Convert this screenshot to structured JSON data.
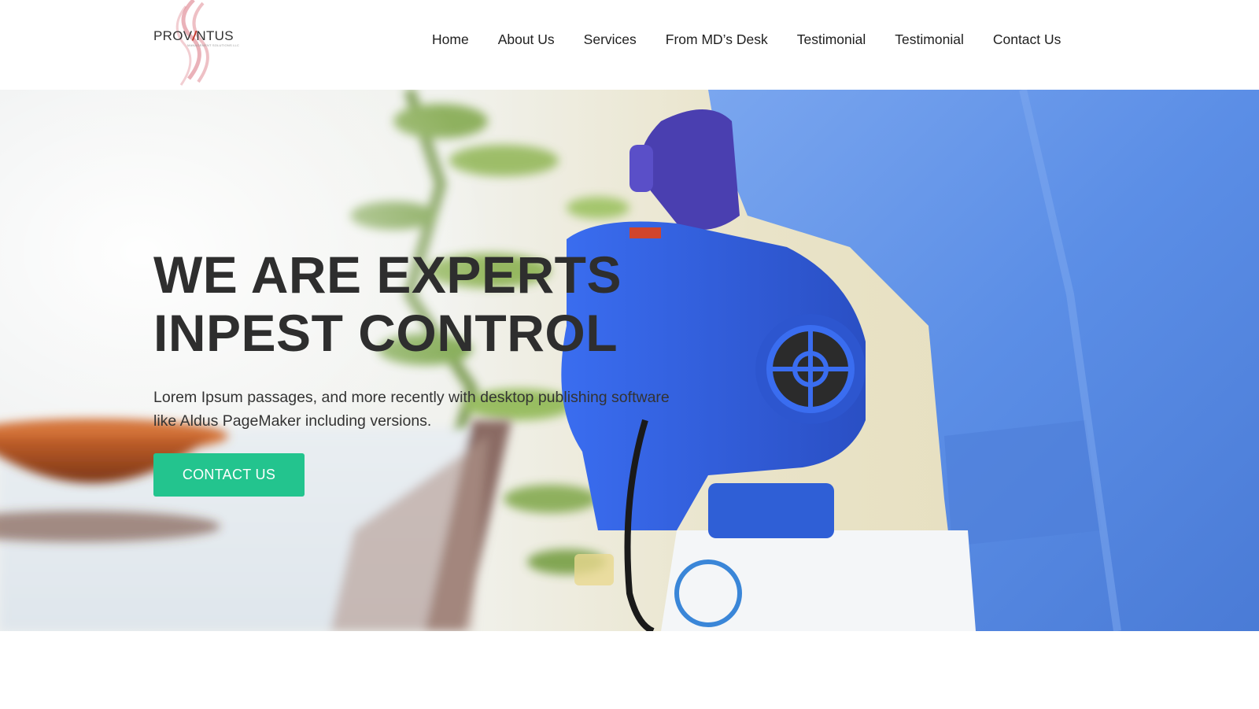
{
  "brand": {
    "name_left": "PROV",
    "name_slash": "/",
    "name_right": "NTUS",
    "tagline": "MANAGEMENT SOLUTIONS LLC"
  },
  "nav": {
    "items": [
      {
        "label": "Home"
      },
      {
        "label": "About Us"
      },
      {
        "label": "Services"
      },
      {
        "label": "From MD’s Desk"
      },
      {
        "label": "Testimonial"
      },
      {
        "label": "Testimonial"
      },
      {
        "label": "Contact Us"
      }
    ]
  },
  "hero": {
    "title_line1": "WE ARE EXPERTS",
    "title_line2": "INPEST CONTROL",
    "description": "Lorem Ipsum passages, and more recently with desktop publishing software like Aldus PageMaker including versions.",
    "cta_label": "CONTACT  US",
    "image_icon": "pest-control-sprayer-image"
  },
  "colors": {
    "accent": "#23c48e",
    "text_dark": "#2e2e2e",
    "logo_swirl": "#d9737f",
    "suit_blue": "#5b8ee6",
    "sprayer_blue": "#2f5fd6"
  }
}
